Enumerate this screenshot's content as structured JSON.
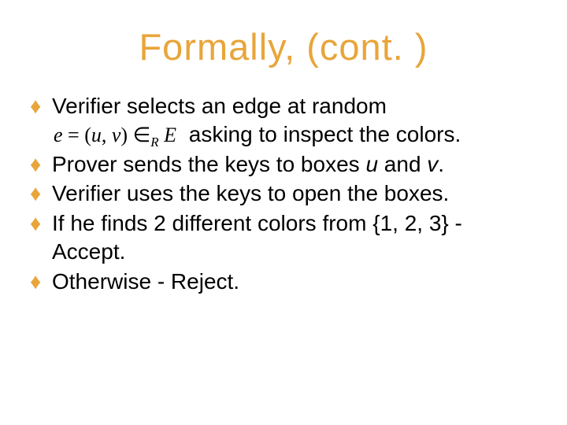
{
  "title": "Formally, (cont. )",
  "bullets": {
    "b1_pre": "Verifier selects an edge at random ",
    "b1_post": " asking to inspect the colors.",
    "b2_a": "Prover sends the keys to boxes ",
    "b2_u": "u",
    "b2_and": " and ",
    "b2_v": "v",
    "b2_end": ".",
    "b3": "Verifier uses the keys to open the boxes.",
    "b4": "If he finds 2 different colors from {1, 2, 3} - Accept.",
    "b5": "Otherwise - Reject."
  },
  "formula": {
    "lhs": "e",
    "eq": " = (",
    "u": "u",
    "comma": ", ",
    "v": "v",
    "rp": ") ",
    "in": "∈",
    "sub": "R",
    "sp": " ",
    "set": "E"
  }
}
